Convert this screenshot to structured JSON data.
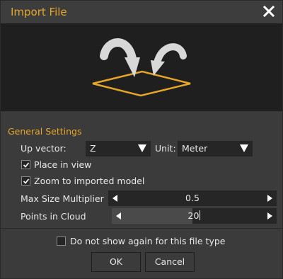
{
  "window": {
    "title": "Import File",
    "close_icon": "close-icon"
  },
  "colors": {
    "accent": "#e6a629",
    "panel": "#3b3b3b",
    "field": "#262626",
    "preview": "#1f1f1f"
  },
  "preview": {
    "icon": "import-arrows-onto-plane-icon"
  },
  "general": {
    "section_title": "General Settings",
    "up_vector_label": "Up vector:",
    "up_vector_value": "Z",
    "unit_label": "Unit:",
    "unit_value": "Meter",
    "place_in_view_label": "Place in view",
    "place_in_view_checked": true,
    "zoom_label": "Zoom to imported model",
    "zoom_checked": true,
    "max_size_label": "Max Size Multiplier",
    "max_size_value": "0.5",
    "points_label": "Points in Cloud",
    "points_value": "20"
  },
  "footer": {
    "dont_show_label": "Do not show again for this file type",
    "dont_show_checked": false,
    "ok_label": "OK",
    "cancel_label": "Cancel"
  }
}
